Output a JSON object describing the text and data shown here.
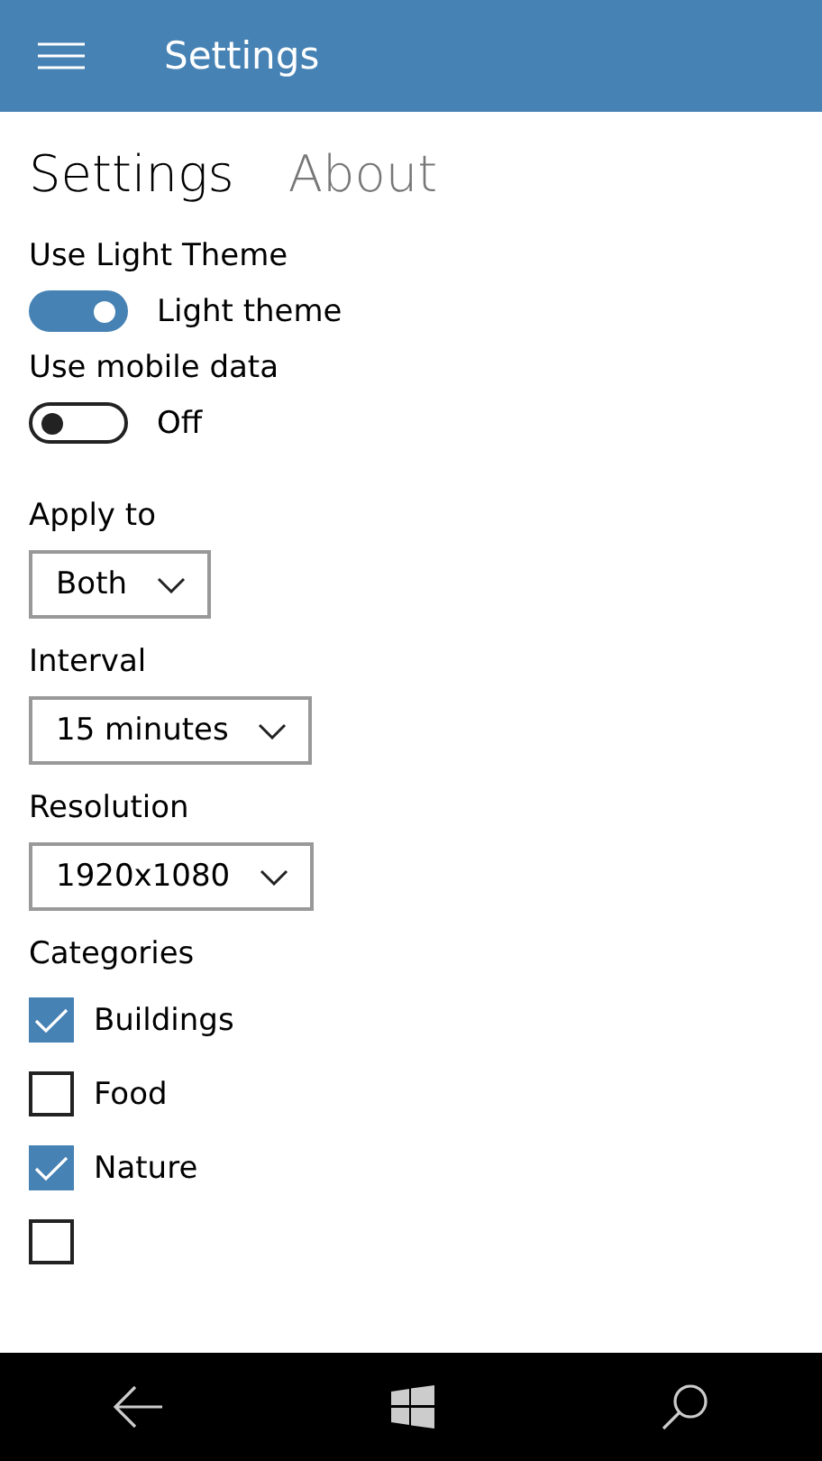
{
  "header": {
    "title": "Settings"
  },
  "tabs": [
    {
      "label": "Settings",
      "selected": true
    },
    {
      "label": "About",
      "selected": false
    }
  ],
  "toggles": [
    {
      "heading": "Use Light Theme",
      "on": true,
      "label": "Light theme"
    },
    {
      "heading": "Use mobile data",
      "on": false,
      "label": "Off"
    }
  ],
  "dropdowns": [
    {
      "label": "Apply to",
      "value": "Both"
    },
    {
      "label": "Interval",
      "value": "15 minutes"
    },
    {
      "label": "Resolution",
      "value": "1920x1080"
    }
  ],
  "categories": {
    "heading": "Categories",
    "items": [
      {
        "label": "Buildings",
        "checked": true
      },
      {
        "label": "Food",
        "checked": false
      },
      {
        "label": "Nature",
        "checked": true
      },
      {
        "checked": false
      }
    ]
  }
}
